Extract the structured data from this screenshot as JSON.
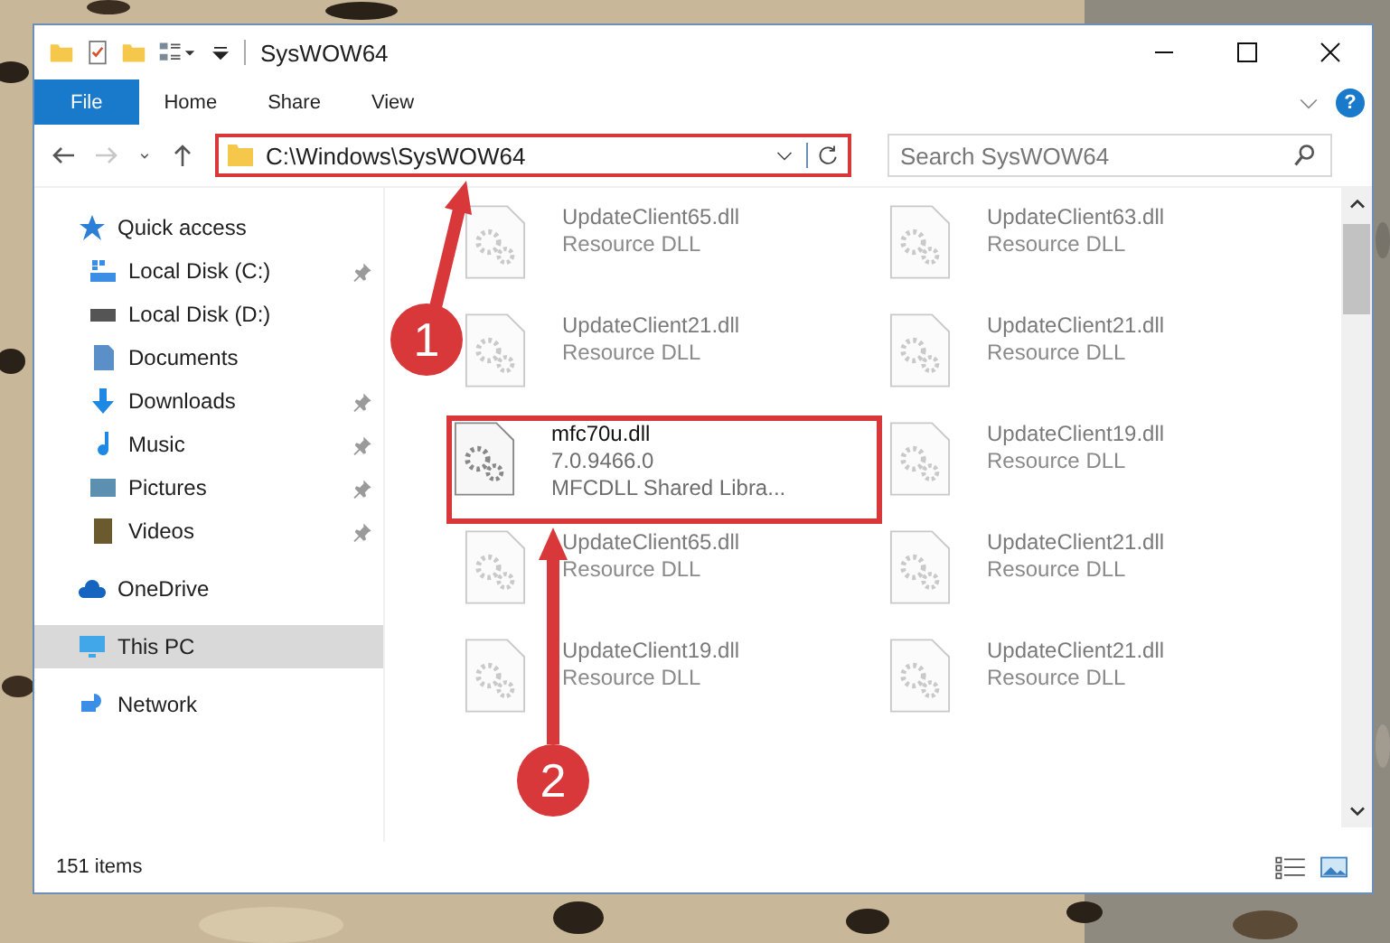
{
  "window": {
    "title": "SysWOW64"
  },
  "ribbon_tabs": [
    {
      "label": "File",
      "selected": true
    },
    {
      "label": "Home",
      "selected": false
    },
    {
      "label": "Share",
      "selected": false
    },
    {
      "label": "View",
      "selected": false
    }
  ],
  "help": "?",
  "nav_buttons": [
    {
      "kind": "back",
      "disabled": false
    },
    {
      "kind": "forward",
      "disabled": true
    },
    {
      "kind": "recent",
      "disabled": false
    },
    {
      "kind": "up",
      "disabled": false
    }
  ],
  "address": {
    "value": "C:\\Windows\\SysWOW64",
    "highlighted": true
  },
  "search": {
    "placeholder": "Search SysWOW64"
  },
  "sidebar": {
    "items": [
      {
        "label": "Quick access",
        "kind": "star",
        "selected": false,
        "children": [
          {
            "label": "Local Disk (C:)",
            "kind": "drive-win",
            "pinned": true,
            "selected": false
          },
          {
            "label": "Local Disk (D:)",
            "kind": "drive",
            "pinned": false,
            "selected": false
          },
          {
            "label": "Documents",
            "kind": "document",
            "pinned": false,
            "selected": false
          },
          {
            "label": "Downloads",
            "kind": "download",
            "pinned": true,
            "selected": false
          },
          {
            "label": "Music",
            "kind": "music",
            "pinned": true,
            "selected": false
          },
          {
            "label": "Pictures",
            "kind": "pictures",
            "pinned": true,
            "selected": false
          },
          {
            "label": "Videos",
            "kind": "video",
            "pinned": true,
            "selected": false
          }
        ]
      },
      {
        "label": "OneDrive",
        "kind": "cloud",
        "selected": false
      },
      {
        "label": "This PC",
        "kind": "monitor",
        "selected": true
      },
      {
        "label": "Network",
        "kind": "network",
        "selected": false
      }
    ]
  },
  "files": [
    {
      "name": "UpdateClient65.dll",
      "lines": [
        "Resource DLL"
      ],
      "dimmed": true,
      "highlighted": false
    },
    {
      "name": "UpdateClient63.dll",
      "lines": [
        "Resource DLL"
      ],
      "dimmed": true,
      "highlighted": false
    },
    {
      "name": "UpdateClient21.dll",
      "lines": [
        "Resource DLL"
      ],
      "dimmed": true,
      "highlighted": false
    },
    {
      "name": "UpdateClient21.dll",
      "lines": [
        "Resource DLL"
      ],
      "dimmed": true,
      "highlighted": false
    },
    {
      "name": "mfc70u.dll",
      "lines": [
        "7.0.9466.0",
        "MFCDLL Shared Libra..."
      ],
      "dimmed": false,
      "highlighted": true
    },
    {
      "name": "UpdateClient19.dll",
      "lines": [
        "Resource DLL"
      ],
      "dimmed": true,
      "highlighted": false
    },
    {
      "name": "UpdateClient65.dll",
      "lines": [
        "Resource DLL"
      ],
      "dimmed": true,
      "highlighted": false
    },
    {
      "name": "UpdateClient21.dll",
      "lines": [
        "Resource DLL"
      ],
      "dimmed": true,
      "highlighted": false
    },
    {
      "name": "UpdateClient19.dll",
      "lines": [
        "Resource DLL"
      ],
      "dimmed": true,
      "highlighted": false
    },
    {
      "name": "UpdateClient21.dll",
      "lines": [
        "Resource DLL"
      ],
      "dimmed": true,
      "highlighted": false
    }
  ],
  "status_bar": {
    "item_count": "151 items"
  },
  "annotations": [
    {
      "label": "1"
    },
    {
      "label": "2"
    }
  ]
}
